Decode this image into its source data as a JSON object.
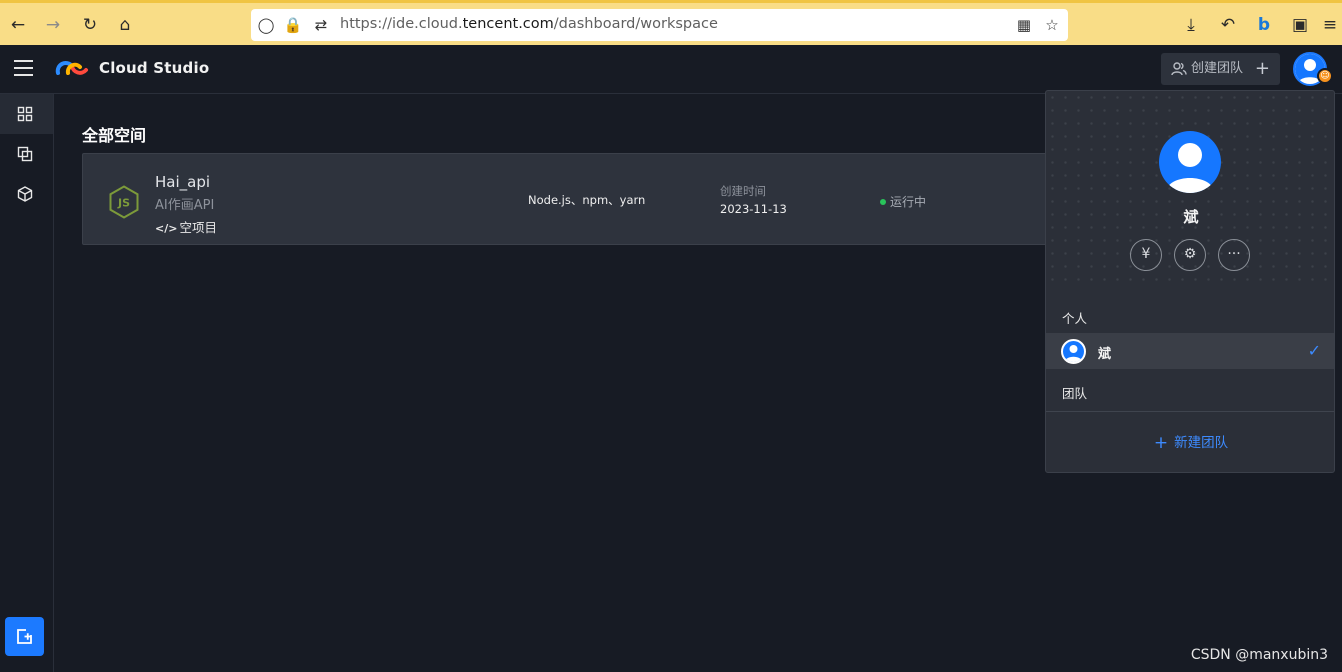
{
  "browser": {
    "url_prefix": "https://ide.cloud.",
    "url_host": "tencent.com",
    "url_path": "/dashboard/workspace"
  },
  "app": {
    "brand": "Cloud Studio",
    "create_team_label": "创建团队"
  },
  "sidebar": {
    "items": [
      "workspace-icon",
      "template-icon",
      "cube-icon"
    ],
    "add_button": "add-workspace-icon"
  },
  "main": {
    "section_title": "全部空间",
    "workspaces": [
      {
        "name": "Hai_api",
        "description": "AI作画API",
        "template": "空项目",
        "template_icon": "</>",
        "env": "Node.js、npm、yarn",
        "created_label": "创建时间",
        "created_date": "2023-11-13",
        "status": "运行中"
      }
    ]
  },
  "user_panel": {
    "user_name": "斌",
    "actions": [
      "¥",
      "⚙",
      "···"
    ],
    "personal_label": "个人",
    "account_name": "斌",
    "team_label": "团队",
    "new_team_label": "新建团队"
  },
  "watermark": "CSDN @manxubin3",
  "colors": {
    "accent": "#1c7aff",
    "status_green": "#29c45b",
    "browser_bar": "#f9dd87"
  }
}
